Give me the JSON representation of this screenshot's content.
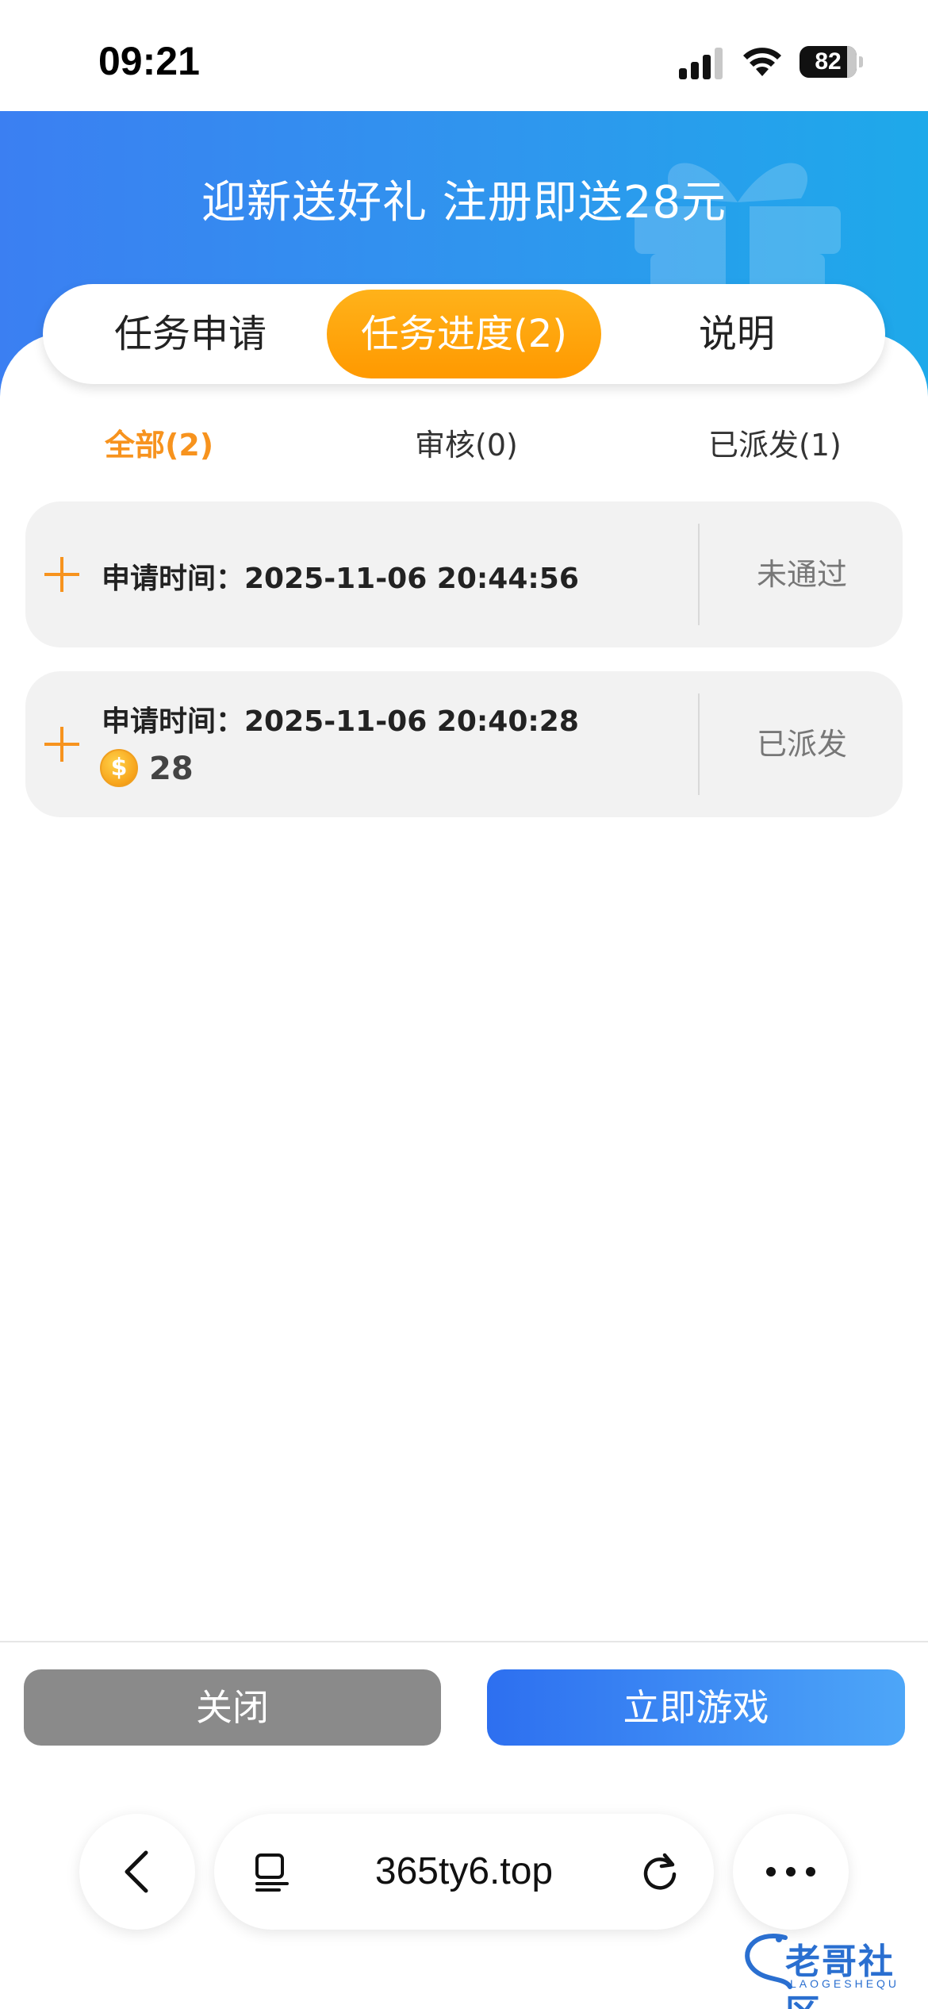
{
  "status_bar": {
    "time": "09:21",
    "battery": "82"
  },
  "header": {
    "title": "迎新送好礼 注册即送28元"
  },
  "tabs": [
    {
      "label": "任务申请",
      "active": false
    },
    {
      "label": "任务进度(2)",
      "active": true
    },
    {
      "label": "说明",
      "active": false
    }
  ],
  "filters": [
    {
      "label": "全部(2)",
      "active": true
    },
    {
      "label": "审核(0)",
      "active": false
    },
    {
      "label": "已派发(1)",
      "active": false
    }
  ],
  "records": [
    {
      "time_text": "申请时间：2025-11-06 20:44:56",
      "status": "未通过"
    },
    {
      "time_text": "申请时间：2025-11-06 20:40:28",
      "reward_amount": "28",
      "status": "已派发"
    }
  ],
  "actions": {
    "close_label": "关闭",
    "play_label": "立即游戏"
  },
  "browser": {
    "url": "365ty6.top"
  },
  "watermark": {
    "text": "老哥社区",
    "sub": "LAOGESHEQU"
  },
  "colors": {
    "accent_orange": "#f7931e",
    "banner_blue": "#3b7ff2",
    "play_blue": "#2d6ff0",
    "close_gray": "#8a8a8a"
  }
}
